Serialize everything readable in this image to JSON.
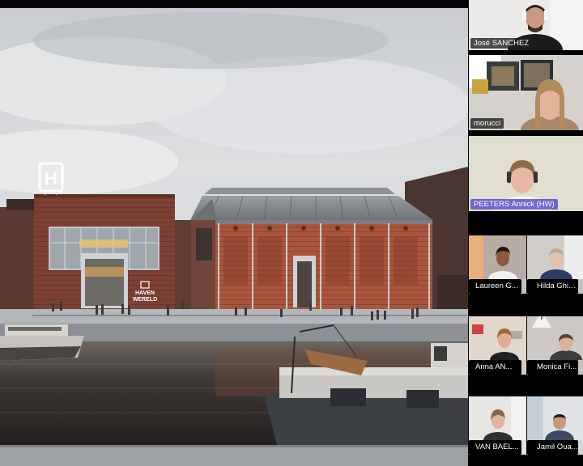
{
  "shared_screen": {
    "building_sign": "HAVEN\nWERELD",
    "building_sign_sub": "",
    "logo_letter": "H"
  },
  "participants": [
    {
      "name": "José SANCHEZ"
    },
    {
      "name": "morucci"
    },
    {
      "name": "PEETERS Annick (HW)"
    },
    {
      "name": "Laureen G..."
    },
    {
      "name": "Hilda Ghiur..."
    },
    {
      "name": "Anna  AN..."
    },
    {
      "name": "Monica Fi..."
    },
    {
      "name": "VAN BAEL..."
    },
    {
      "name": "Jamil Oua..."
    }
  ],
  "colors": {
    "speaker_outline": "#e8c84a",
    "brick": "#a8543c",
    "water": "#2b2622"
  }
}
